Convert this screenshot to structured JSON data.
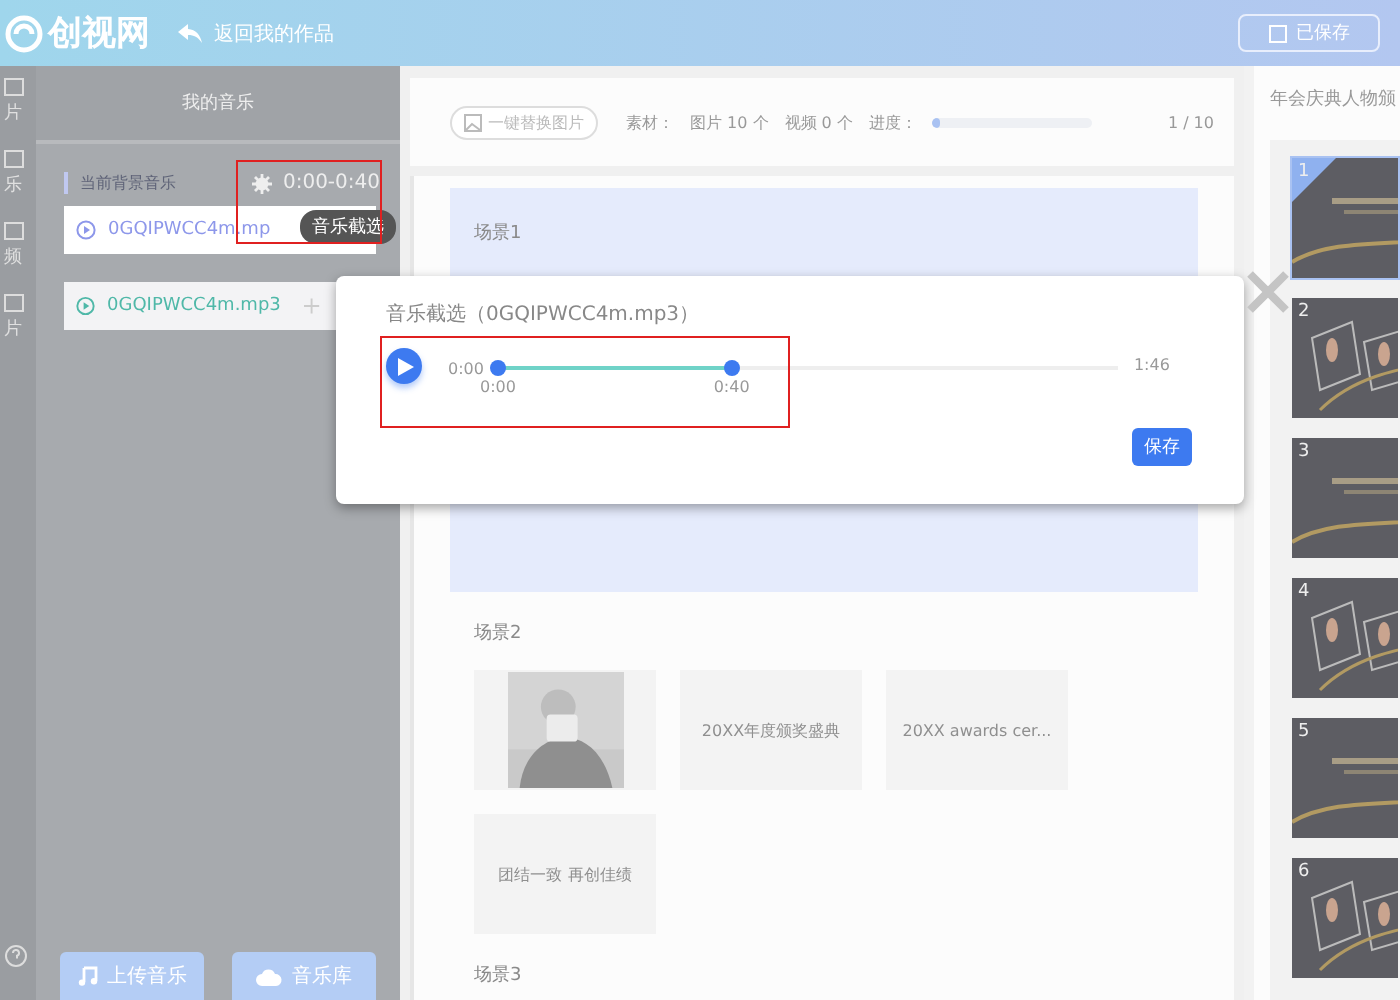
{
  "topbar": {
    "logo": "创视网",
    "back": "返回我的作品",
    "save_status": "已保存"
  },
  "rail": {
    "items": [
      {
        "label": "片"
      },
      {
        "label": "乐"
      },
      {
        "label": "频"
      },
      {
        "label": "片"
      }
    ]
  },
  "music_panel": {
    "title": "我的音乐",
    "current_label": "当前背景音乐",
    "current_range": "0:00-0:40",
    "tooltip": "音乐截选",
    "tracks": [
      {
        "name": "0GQIPWCC4m.mp",
        "selected": true
      },
      {
        "name": "0GQIPWCC4m.mp3",
        "selected": false
      }
    ],
    "buttons": [
      {
        "kind": "upload",
        "label": "上传音乐"
      },
      {
        "kind": "library",
        "label": "音乐库"
      }
    ]
  },
  "toolbar": {
    "replace_button": "一键替换图片",
    "material_label": "素材：",
    "images": "图片 10 个",
    "videos": "视频 0 个",
    "progress_label": "进度：",
    "progress": {
      "level": 0.05
    },
    "page": "1 / 10"
  },
  "scenes": [
    {
      "title": "场景1",
      "selected": true
    },
    {
      "title": "场景2",
      "selected": false,
      "tiles": [
        {
          "kind": "picture"
        },
        {
          "kind": "text",
          "text": "20XX年度颁奖盛典"
        },
        {
          "kind": "text",
          "text": "20XX awards cer..."
        },
        {
          "kind": "text",
          "text": "团结一致 再创佳绩"
        }
      ]
    },
    {
      "title": "场景3",
      "selected": false
    }
  ],
  "preview": {
    "title": "年会庆典人物颁",
    "slides": [
      {
        "number": "1",
        "selected": true,
        "kind": "title"
      },
      {
        "number": "2",
        "selected": false,
        "kind": "trophy"
      },
      {
        "number": "3",
        "selected": false,
        "kind": "title"
      },
      {
        "number": "4",
        "selected": false,
        "kind": "trophy"
      },
      {
        "number": "5",
        "selected": false,
        "kind": "title"
      },
      {
        "number": "6",
        "selected": false,
        "kind": "trophy"
      }
    ]
  },
  "dialog": {
    "title": "音乐截选（0GQIPWCC4m.mp3）",
    "start_time": "0:00",
    "range_start": {
      "level": 0
    },
    "range_end": {
      "level": 0.377
    },
    "start_label": "0:00",
    "end_label": "0:40",
    "duration": "1:46",
    "save": "保存"
  }
}
